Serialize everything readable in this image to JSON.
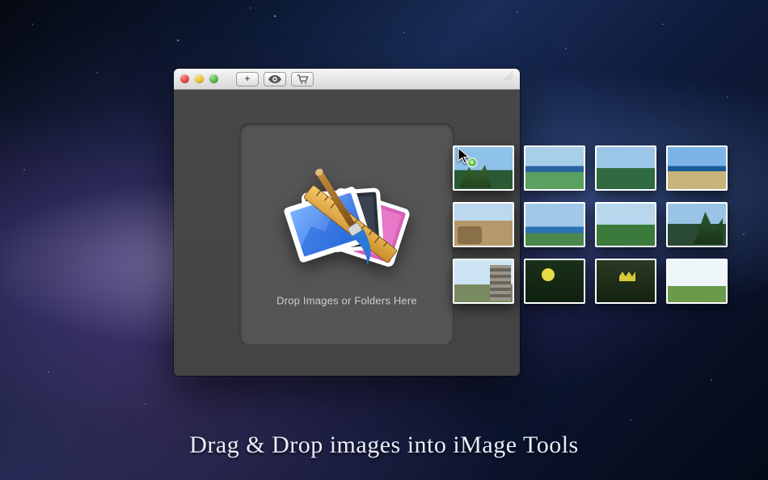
{
  "toolbar": {
    "add_label": "+",
    "preview_label": "preview",
    "cart_label": "cart"
  },
  "dropzone": {
    "hint": "Drop Images or Folders Here"
  },
  "caption": "Drag & Drop images into iMage Tools",
  "thumbnails": [
    {
      "name": "thumb-1"
    },
    {
      "name": "thumb-2"
    },
    {
      "name": "thumb-3"
    },
    {
      "name": "thumb-4"
    },
    {
      "name": "thumb-5"
    },
    {
      "name": "thumb-6"
    },
    {
      "name": "thumb-7"
    },
    {
      "name": "thumb-8"
    },
    {
      "name": "thumb-9"
    },
    {
      "name": "thumb-10"
    },
    {
      "name": "thumb-11"
    },
    {
      "name": "thumb-12"
    }
  ],
  "cursor_badge_glyph": "+"
}
